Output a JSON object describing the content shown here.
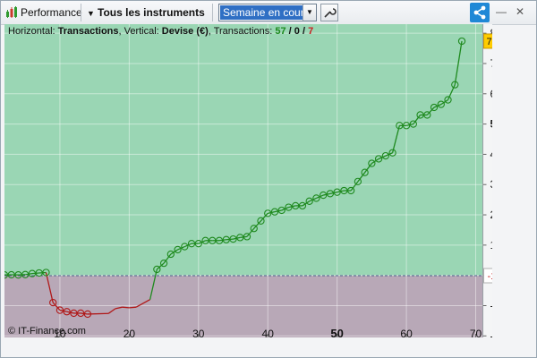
{
  "toolbar": {
    "performance_label": "Performance",
    "instruments_label": "Tous les instruments",
    "period_select": "Semaine en cours",
    "minimize_symbol": "—",
    "close_symbol": "✕"
  },
  "header": {
    "horizontal_prefix": "Horizontal: ",
    "horizontal_value": "Transactions",
    "vertical_prefix": ", Vertical: ",
    "vertical_value": "Devise (€)",
    "transactions_prefix": ", Transactions: ",
    "wins": "57",
    "slash1": " / ",
    "breakeven": "0",
    "slash2": " / ",
    "losses": "7"
  },
  "credit": "© IT-Finance.com",
  "colors": {
    "positive_bg": "#9ad6b4",
    "negative_bg": "#b8a8b7",
    "line_positive": "#1f8a1f",
    "line_negative": "#b01818",
    "marker_bg": "#ffcc00",
    "accent": "#1f88d6"
  },
  "chart_data": {
    "type": "line",
    "xlim": [
      2,
      72
    ],
    "ylim": [
      -2050,
      8300
    ],
    "x_ticks": [
      "10",
      "20",
      "30",
      "40",
      "50",
      "60",
      "70"
    ],
    "y_ticks": [
      "8 000",
      "7 000",
      "6 000",
      "5 000",
      "4 000",
      "3 000",
      "2 000",
      "1 000",
      "0",
      "-1 000",
      "-2 000"
    ],
    "baseline_label": "-10",
    "last_value_label": "7 739,46",
    "grid": true,
    "series": [
      {
        "points": [
          [
            2,
            15
          ],
          [
            3,
            20
          ],
          [
            4,
            15
          ],
          [
            5,
            25
          ],
          [
            6,
            60
          ],
          [
            7,
            80
          ],
          [
            8,
            95
          ],
          [
            9,
            -900
          ],
          [
            10,
            -1150
          ],
          [
            11,
            -1200
          ],
          [
            12,
            -1250
          ],
          [
            13,
            -1250
          ],
          [
            14,
            -1280
          ],
          [
            17,
            -1260
          ],
          [
            18,
            -1100
          ],
          [
            19,
            -1050
          ],
          [
            20,
            -1070
          ],
          [
            21,
            -1050
          ],
          [
            23,
            -800
          ],
          [
            24,
            200
          ],
          [
            25,
            400
          ],
          [
            26,
            700
          ],
          [
            27,
            850
          ],
          [
            28,
            950
          ],
          [
            29,
            1050
          ],
          [
            30,
            1050
          ],
          [
            31,
            1150
          ],
          [
            32,
            1150
          ],
          [
            33,
            1150
          ],
          [
            34,
            1180
          ],
          [
            35,
            1200
          ],
          [
            36,
            1250
          ],
          [
            37,
            1280
          ],
          [
            38,
            1550
          ],
          [
            39,
            1800
          ],
          [
            40,
            2050
          ],
          [
            41,
            2100
          ],
          [
            42,
            2150
          ],
          [
            43,
            2250
          ],
          [
            44,
            2300
          ],
          [
            45,
            2300
          ],
          [
            46,
            2450
          ],
          [
            47,
            2550
          ],
          [
            48,
            2650
          ],
          [
            49,
            2700
          ],
          [
            50,
            2750
          ],
          [
            51,
            2800
          ],
          [
            52,
            2800
          ],
          [
            53,
            3100
          ],
          [
            54,
            3400
          ],
          [
            55,
            3700
          ],
          [
            56,
            3850
          ],
          [
            57,
            3950
          ],
          [
            58,
            4050
          ],
          [
            59,
            4950
          ],
          [
            60,
            4950
          ],
          [
            61,
            5000
          ],
          [
            62,
            5300
          ],
          [
            63,
            5300
          ],
          [
            64,
            5550
          ],
          [
            65,
            5650
          ],
          [
            66,
            5800
          ],
          [
            67,
            6300
          ],
          [
            68,
            7739
          ]
        ]
      }
    ]
  }
}
